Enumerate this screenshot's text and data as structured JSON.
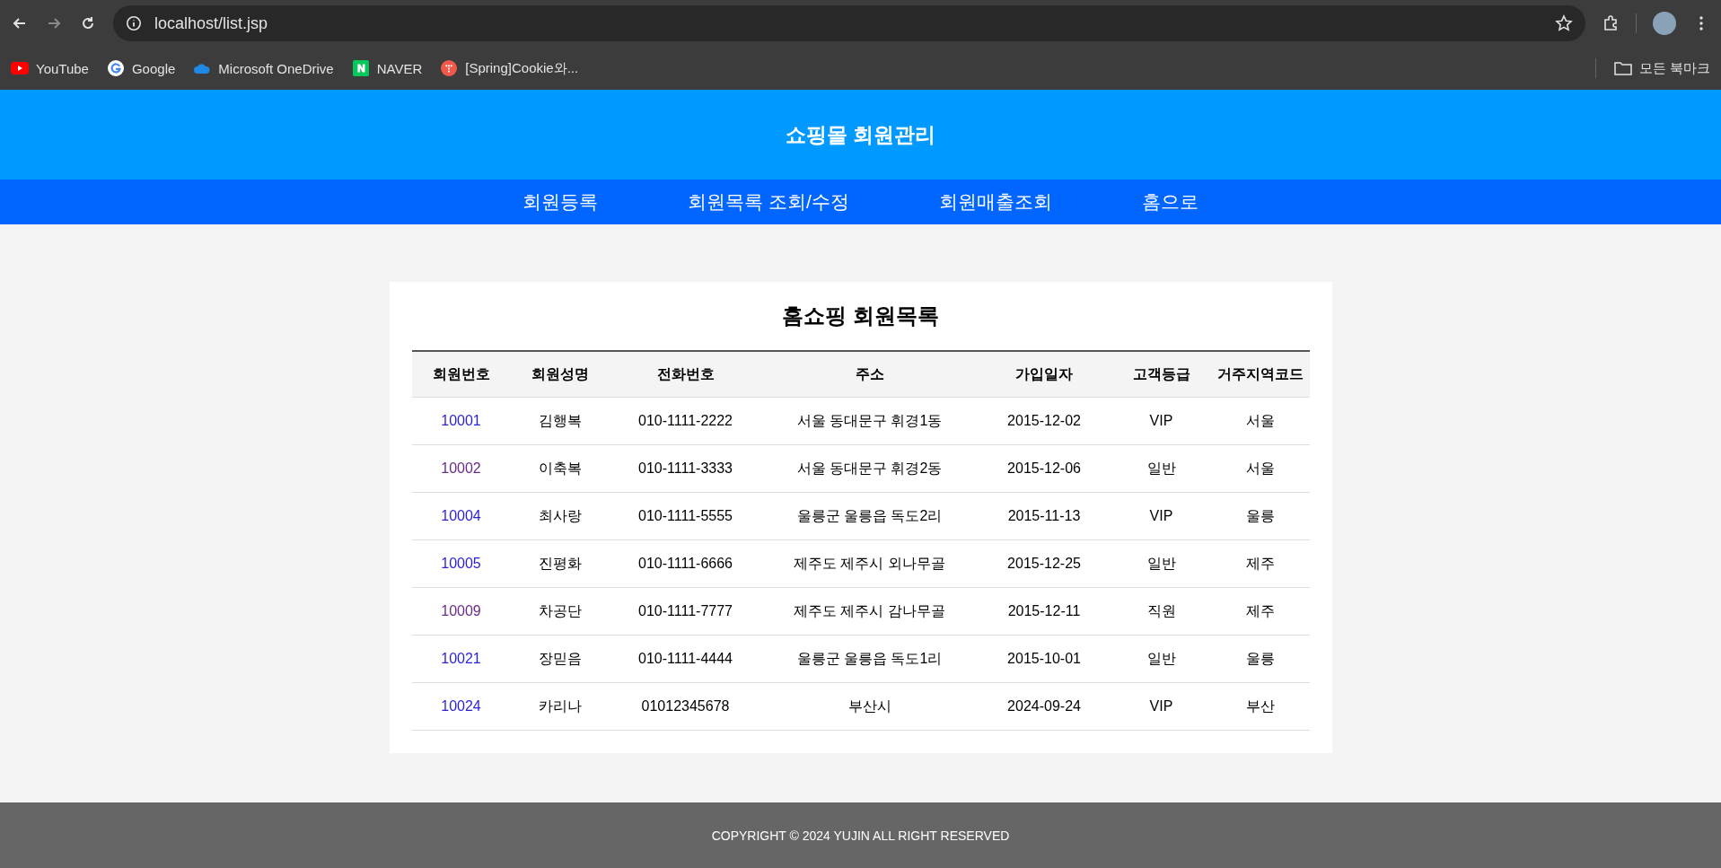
{
  "browser": {
    "url": "localhost/list.jsp",
    "bookmarks": [
      {
        "label": "YouTube",
        "kind": "youtube"
      },
      {
        "label": "Google",
        "kind": "google"
      },
      {
        "label": "Microsoft OneDrive",
        "kind": "cloud"
      },
      {
        "label": "NAVER",
        "kind": "naver"
      },
      {
        "label": "[Spring]Cookie와...",
        "kind": "dots"
      }
    ],
    "all_bookmarks": "모든 북마크"
  },
  "header": {
    "title": "쇼핑몰 회원관리"
  },
  "nav": [
    "회원등록",
    "회원목록 조회/수정",
    "회원매출조회",
    "홈으로"
  ],
  "table": {
    "title": "홈쇼핑 회원목록",
    "columns": [
      "회원번호",
      "회원성명",
      "전화번호",
      "주소",
      "가입일자",
      "고객등급",
      "거주지역코드"
    ],
    "rows": [
      {
        "visited": false,
        "cells": [
          "10001",
          "김행복",
          "010-1111-2222",
          "서울 동대문구 휘경1동",
          "2015-12-02",
          "VIP",
          "서울"
        ]
      },
      {
        "visited": true,
        "cells": [
          "10002",
          "이축복",
          "010-1111-3333",
          "서울 동대문구 휘경2동",
          "2015-12-06",
          "일반",
          "서울"
        ]
      },
      {
        "visited": false,
        "cells": [
          "10004",
          "최사랑",
          "010-1111-5555",
          "울릉군 울릉읍 독도2리",
          "2015-11-13",
          "VIP",
          "울릉"
        ]
      },
      {
        "visited": false,
        "cells": [
          "10005",
          "진평화",
          "010-1111-6666",
          "제주도 제주시 외나무골",
          "2015-12-25",
          "일반",
          "제주"
        ]
      },
      {
        "visited": true,
        "cells": [
          "10009",
          "차공단",
          "010-1111-7777",
          "제주도 제주시 감나무골",
          "2015-12-11",
          "직원",
          "제주"
        ]
      },
      {
        "visited": false,
        "cells": [
          "10021",
          "장믿음",
          "010-1111-4444",
          "울릉군 울릉읍 독도1리",
          "2015-10-01",
          "일반",
          "울릉"
        ]
      },
      {
        "visited": false,
        "cells": [
          "10024",
          "카리나",
          "01012345678",
          "부산시",
          "2024-09-24",
          "VIP",
          "부산"
        ]
      }
    ]
  },
  "footer": "COPYRIGHT © 2024 YUJIN ALL RIGHT RESERVED"
}
